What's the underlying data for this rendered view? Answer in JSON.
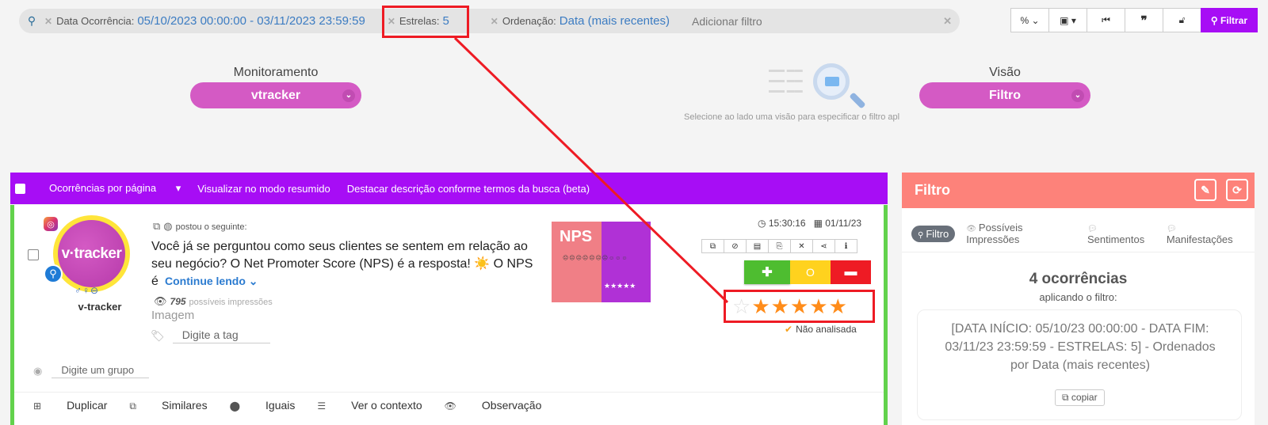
{
  "filter_bar": {
    "chips": [
      {
        "key": "Data Ocorrência:",
        "value": "05/10/2023 00:00:00 - 03/11/2023 23:59:59"
      },
      {
        "key": "Estrelas:",
        "value": "5"
      },
      {
        "key": "Ordenação:",
        "value": "Data (mais recentes)"
      }
    ],
    "add_filter_label": "Adicionar filtro"
  },
  "toolbar": {
    "percent_label": "%",
    "filter_button_label": "Filtrar"
  },
  "monitoramento": {
    "label": "Monitoramento",
    "value": "vtracker"
  },
  "visao": {
    "label": "Visão",
    "value": "Filtro"
  },
  "visao_hint": "Selecione ao lado uma visão para especificar o filtro apl",
  "list_header": {
    "per_page_label": "Ocorrências por página",
    "summary_mode_label": "Visualizar no modo resumido",
    "highlight_label": "Destacar descrição conforme termos da busca (beta)"
  },
  "post": {
    "avatar_text": "v·tracker",
    "username": "v-tracker",
    "posted_label": "postou o seguinte:",
    "text": "Você já se perguntou como seus clientes se sentem em relação ao seu negócio? O Net Promoter Score (NPS) é a resposta! ☀️  O NPS é",
    "continue_label": "Continue lendo",
    "impressions_count": "795",
    "impressions_label": "possíveis impressões",
    "media_type": "Imagem",
    "tag_placeholder": "Digite a tag",
    "group_placeholder": "Digite um grupo",
    "time": "15:30:16",
    "date": "01/11/23",
    "thumbnail_title": "NPS",
    "vote_neutral": "O",
    "rating": 5,
    "rating_max": 6,
    "status": "Não analisada",
    "actions": [
      "Duplicar",
      "Similares",
      "Iguais",
      "Ver o contexto",
      "Observação"
    ]
  },
  "right_panel": {
    "title": "Filtro",
    "tabs": [
      "Filtro",
      "Possíveis Impressões",
      "Sentimentos",
      "Manifestações"
    ],
    "count_text": "4 ocorrências",
    "applying_text": "aplicando o filtro:",
    "filter_text": "[DATA INÍCIO: 05/10/23 00:00:00 - DATA FIM: 03/11/23 23:59:59 - ESTRELAS: 5] - Ordenados por Data (mais recentes)",
    "copy_label": "copiar"
  },
  "colors": {
    "accent_purple": "#a70df5",
    "pill_pink": "#d45ac4",
    "panel_header": "#fd827a",
    "annotation_red": "#ee1b24",
    "star_on": "#ff8c1a"
  }
}
